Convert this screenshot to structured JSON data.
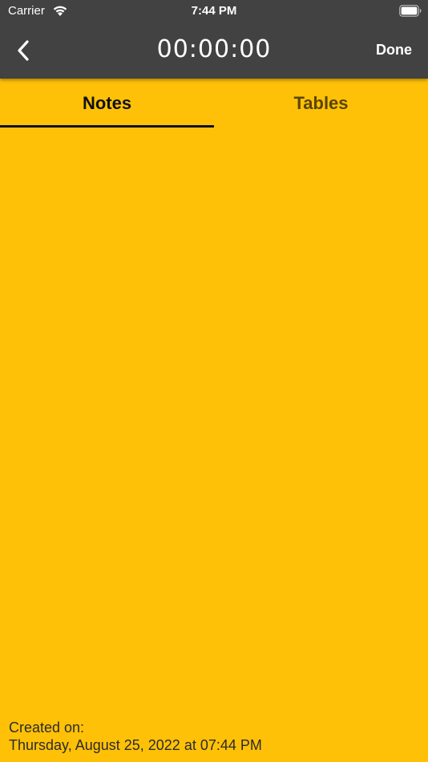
{
  "status_bar": {
    "carrier": "Carrier",
    "time": "7:44 PM"
  },
  "nav": {
    "timer": "00:00:00",
    "done_label": "Done"
  },
  "tabs": [
    {
      "label": "Notes",
      "selected": true
    },
    {
      "label": "Tables",
      "selected": false
    }
  ],
  "footer": {
    "created_label": "Created on:",
    "created_date": "Thursday, August 25, 2022 at 07:44 PM"
  },
  "colors": {
    "background": "#FFC107",
    "topbar": "#424242",
    "indicator": "#111111"
  },
  "icons": {
    "back": "chevron-left-icon",
    "wifi": "wifi-icon",
    "battery": "battery-icon"
  }
}
